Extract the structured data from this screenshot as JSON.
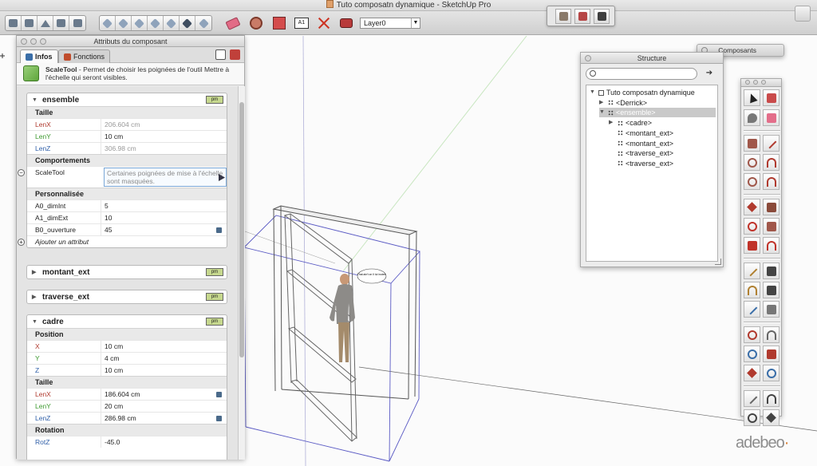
{
  "window": {
    "title": "Tuto composatn dynamique - SketchUp Pro"
  },
  "toolbar": {
    "layer_value": "Layer0",
    "dimension_label": "A1"
  },
  "attributes_panel": {
    "title": "Attributs du composant",
    "tabs": [
      {
        "label": "Infos",
        "active": true
      },
      {
        "label": "Fonctions",
        "active": false
      }
    ],
    "description_title": "ScaleTool",
    "description_text": " - Permet de choisir les poignées de l'outil Mettre à l'échelle qui seront visibles.",
    "badge_label": "pm",
    "sections": [
      {
        "name": "ensemble",
        "expanded": true,
        "groups": [
          {
            "title": "Taille",
            "rows": [
              {
                "key": "LenX",
                "value": "206.604 cm"
              },
              {
                "key": "LenY",
                "value": "10 cm"
              },
              {
                "key": "LenZ",
                "value": "306.98 cm"
              }
            ]
          },
          {
            "title": "Comportements",
            "rows": [
              {
                "key": "ScaleTool",
                "value": "Certaines poignées de mise à l'échelle sont masquées."
              }
            ]
          },
          {
            "title": "Personnalisée",
            "rows": [
              {
                "key": "A0_dimInt",
                "value": "5"
              },
              {
                "key": "A1_dimExt",
                "value": "10"
              },
              {
                "key": "B0_ouverture",
                "value": "45"
              }
            ]
          }
        ],
        "add_attribute": "Ajouter un attribut"
      },
      {
        "name": "montant_ext",
        "expanded": false
      },
      {
        "name": "traverse_ext",
        "expanded": false
      },
      {
        "name": "cadre",
        "expanded": true,
        "groups": [
          {
            "title": "Position",
            "rows": [
              {
                "key": "X",
                "value": "10 cm"
              },
              {
                "key": "Y",
                "value": "4 cm"
              },
              {
                "key": "Z",
                "value": "10 cm"
              }
            ]
          },
          {
            "title": "Taille",
            "rows": [
              {
                "key": "LenX",
                "value": "186.604 cm"
              },
              {
                "key": "LenY",
                "value": "20 cm"
              },
              {
                "key": "LenZ",
                "value": "286.98 cm"
              }
            ]
          },
          {
            "title": "Rotation",
            "rows": [
              {
                "key": "RotZ",
                "value": "-45.0"
              }
            ]
          }
        ]
      }
    ]
  },
  "structure_panel": {
    "title": "Structure",
    "search_value": "",
    "tree": [
      {
        "label": "Tuto composatn dynamique",
        "depth": 0,
        "expanded": true,
        "selected": false,
        "kind": "model"
      },
      {
        "label": "<Derrick>",
        "depth": 1,
        "expanded": false,
        "selected": false,
        "kind": "component"
      },
      {
        "label": "<ensemble>",
        "depth": 1,
        "expanded": true,
        "selected": true,
        "kind": "component"
      },
      {
        "label": "<cadre>",
        "depth": 2,
        "expanded": false,
        "selected": false,
        "kind": "component"
      },
      {
        "label": "<montant_ext>",
        "depth": 2,
        "expanded": false,
        "selected": false,
        "kind": "component"
      },
      {
        "label": "<montant_ext>",
        "depth": 2,
        "expanded": false,
        "selected": false,
        "kind": "component"
      },
      {
        "label": "<traverse_ext>",
        "depth": 2,
        "expanded": false,
        "selected": false,
        "kind": "component"
      },
      {
        "label": "<traverse_ext>",
        "depth": 2,
        "expanded": false,
        "selected": false,
        "kind": "component"
      }
    ]
  },
  "components_panel": {
    "title": "Composants"
  },
  "scene": {
    "speech_bubble": "That ain't on Il lui inutes."
  },
  "brand": {
    "name": "adebeo"
  }
}
